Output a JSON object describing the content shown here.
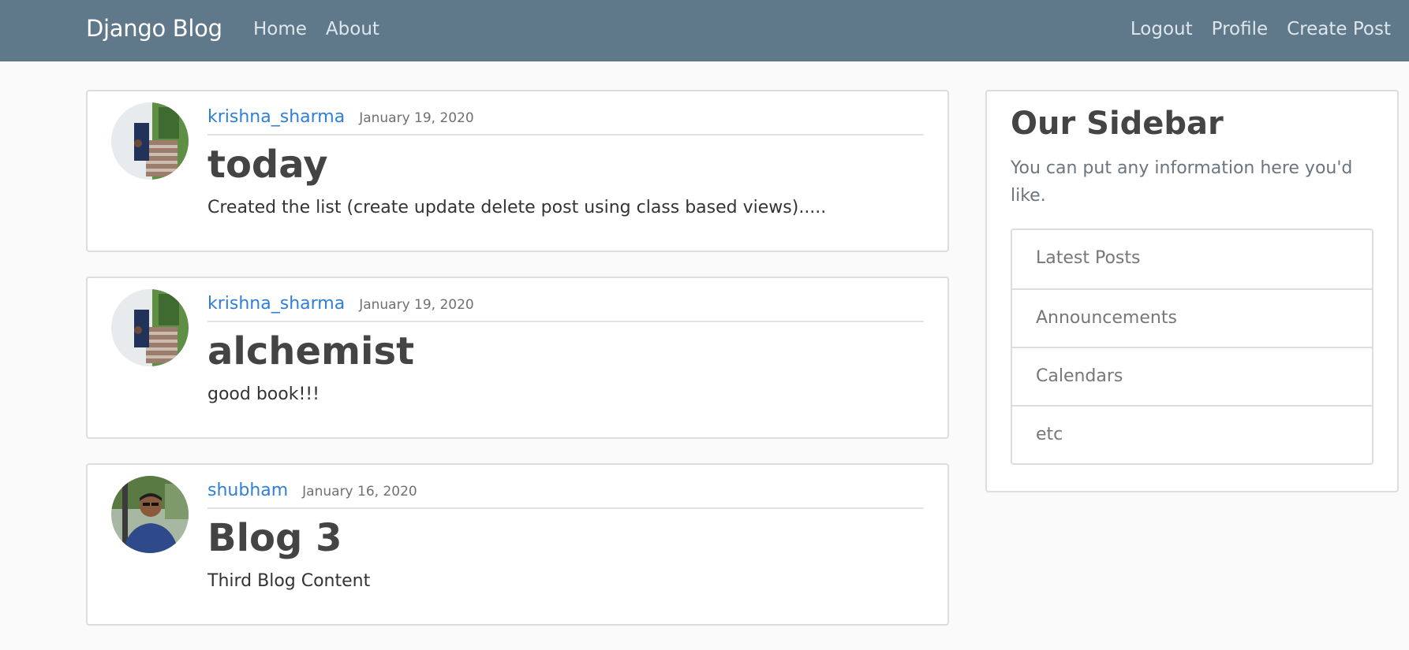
{
  "navbar": {
    "brand": "Django Blog",
    "left_links": [
      {
        "label": "Home"
      },
      {
        "label": "About"
      }
    ],
    "right_links": [
      {
        "label": "Logout"
      },
      {
        "label": "Profile"
      },
      {
        "label": "Create Post"
      }
    ],
    "background_color": "#5f788a"
  },
  "posts": [
    {
      "author": "krishna_sharma",
      "date": "January 19, 2020",
      "title": "today",
      "content": "Created the list (create update delete post using class based views).....",
      "avatar_icon": "user-avatar-photo"
    },
    {
      "author": "krishna_sharma",
      "date": "January 19, 2020",
      "title": "alchemist",
      "content": "good book!!!",
      "avatar_icon": "user-avatar-photo"
    },
    {
      "author": "shubham",
      "date": "January 16, 2020",
      "title": "Blog 3",
      "content": "Third Blog Content",
      "avatar_icon": "user-avatar-photo"
    }
  ],
  "sidebar": {
    "title": "Our Sidebar",
    "description": "You can put any information here you'd like.",
    "items": [
      {
        "label": "Latest Posts"
      },
      {
        "label": "Announcements"
      },
      {
        "label": "Calendars"
      },
      {
        "label": "etc"
      }
    ]
  },
  "colors": {
    "link": "#2f7fd6",
    "page_background": "#fafafa"
  }
}
